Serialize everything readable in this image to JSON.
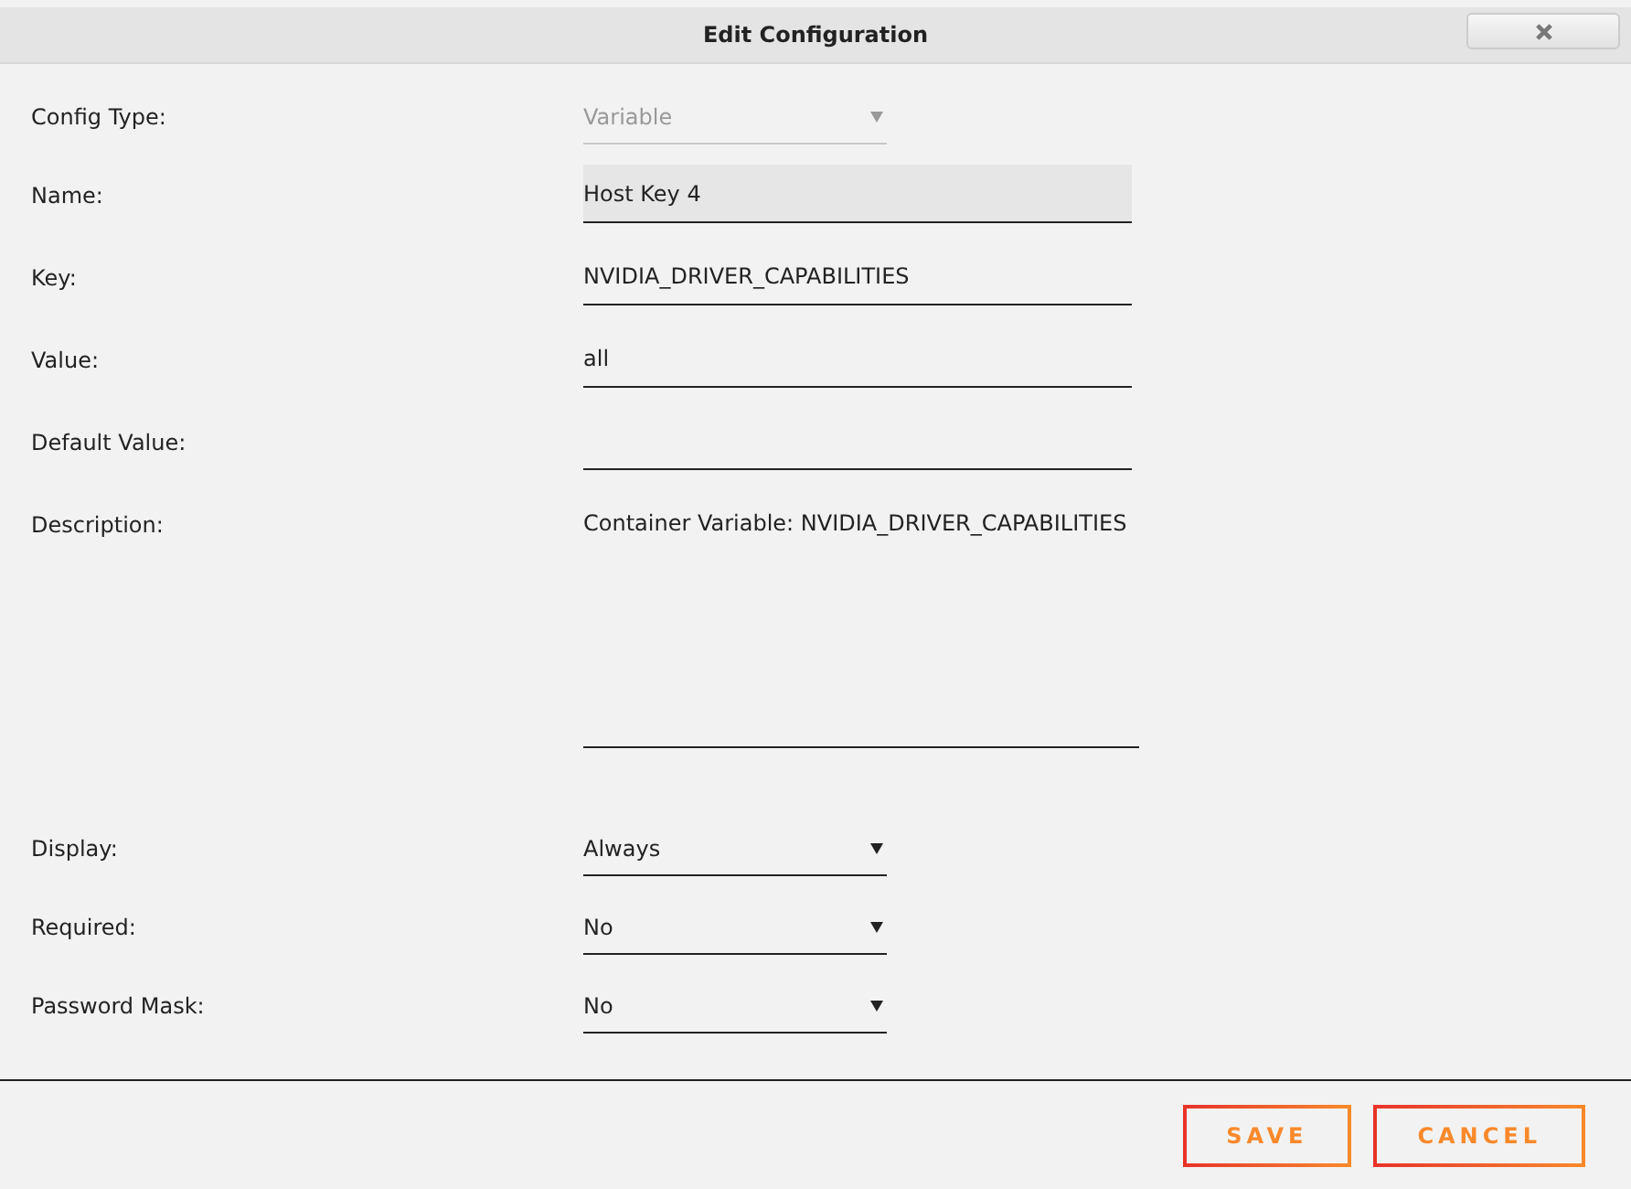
{
  "window": {
    "title": "Edit Configuration"
  },
  "fields": [
    {
      "label": "Config Type:",
      "kind": "select",
      "value": "Variable",
      "disabled": true
    },
    {
      "label": "Name:",
      "kind": "text",
      "value": "Host Key 4",
      "focused": true
    },
    {
      "label": "Key:",
      "kind": "text",
      "value": "NVIDIA_DRIVER_CAPABILITIES",
      "focused": false
    },
    {
      "label": "Value:",
      "kind": "text",
      "value": "all",
      "focused": false
    },
    {
      "label": "Default Value:",
      "kind": "text",
      "focused": false
    },
    {
      "label": "Description:",
      "kind": "textarea",
      "value": "Container Variable: NVIDIA_DRIVER_CAPABILITIES"
    },
    {
      "label": "Display:",
      "kind": "select",
      "value": "Always",
      "disabled": false
    },
    {
      "label": "Required:",
      "kind": "select",
      "value": "No",
      "disabled": false
    },
    {
      "label": "Password Mask:",
      "kind": "select",
      "value": "No",
      "disabled": false
    }
  ],
  "buttons": [
    {
      "label": "SAVE"
    },
    {
      "label": "CANCEL"
    }
  ]
}
